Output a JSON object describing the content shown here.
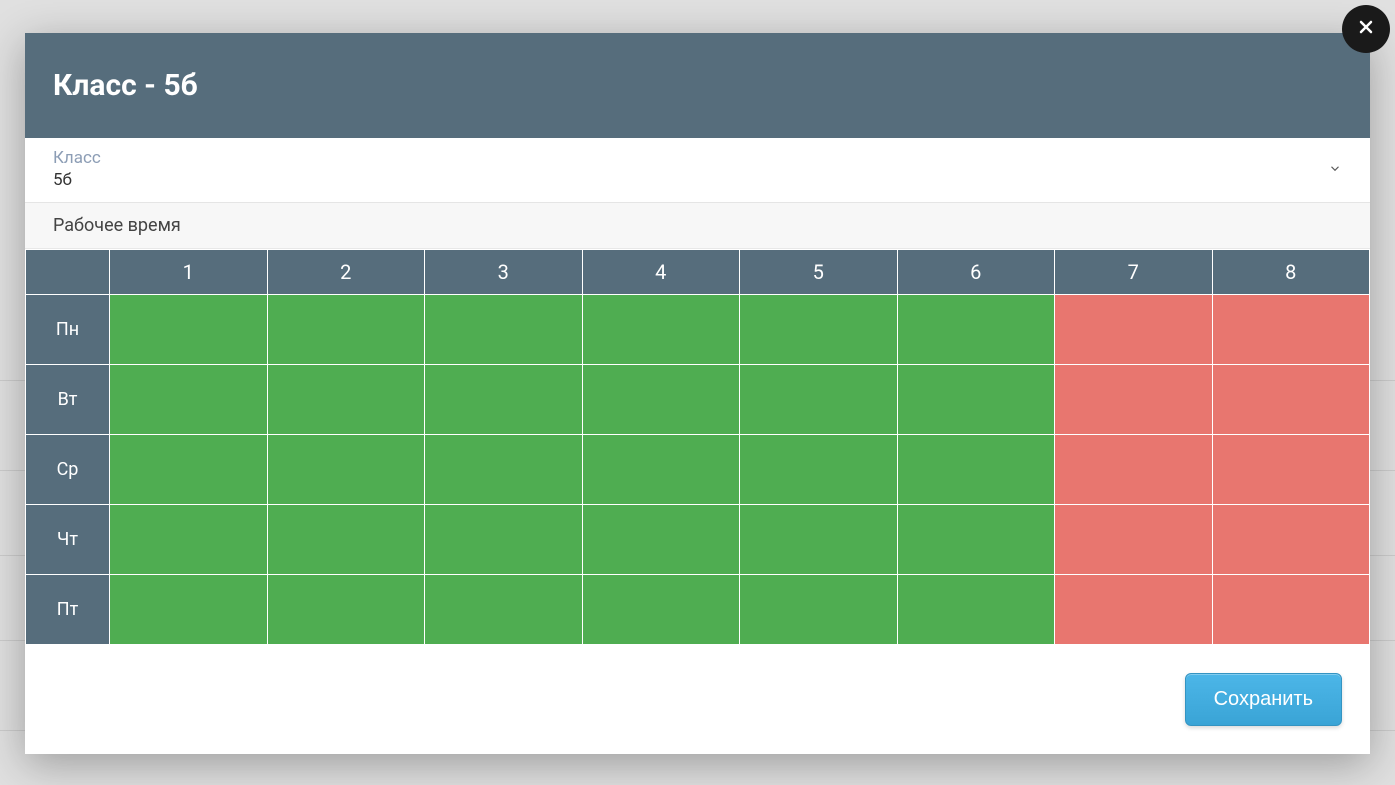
{
  "modal": {
    "title": "Класс - 5б",
    "select": {
      "label": "Класс",
      "value": "5б"
    },
    "section_header": "Рабочее время",
    "save_button": "Сохранить"
  },
  "schedule": {
    "periods": [
      "1",
      "2",
      "3",
      "4",
      "5",
      "6",
      "7",
      "8"
    ],
    "days": [
      "Пн",
      "Вт",
      "Ср",
      "Чт",
      "Пт"
    ],
    "grid": [
      [
        "available",
        "available",
        "available",
        "available",
        "available",
        "available",
        "unavailable",
        "unavailable"
      ],
      [
        "available",
        "available",
        "available",
        "available",
        "available",
        "available",
        "unavailable",
        "unavailable"
      ],
      [
        "available",
        "available",
        "available",
        "available",
        "available",
        "available",
        "unavailable",
        "unavailable"
      ],
      [
        "available",
        "available",
        "available",
        "available",
        "available",
        "available",
        "unavailable",
        "unavailable"
      ],
      [
        "available",
        "available",
        "available",
        "available",
        "available",
        "available",
        "unavailable",
        "unavailable"
      ]
    ]
  }
}
